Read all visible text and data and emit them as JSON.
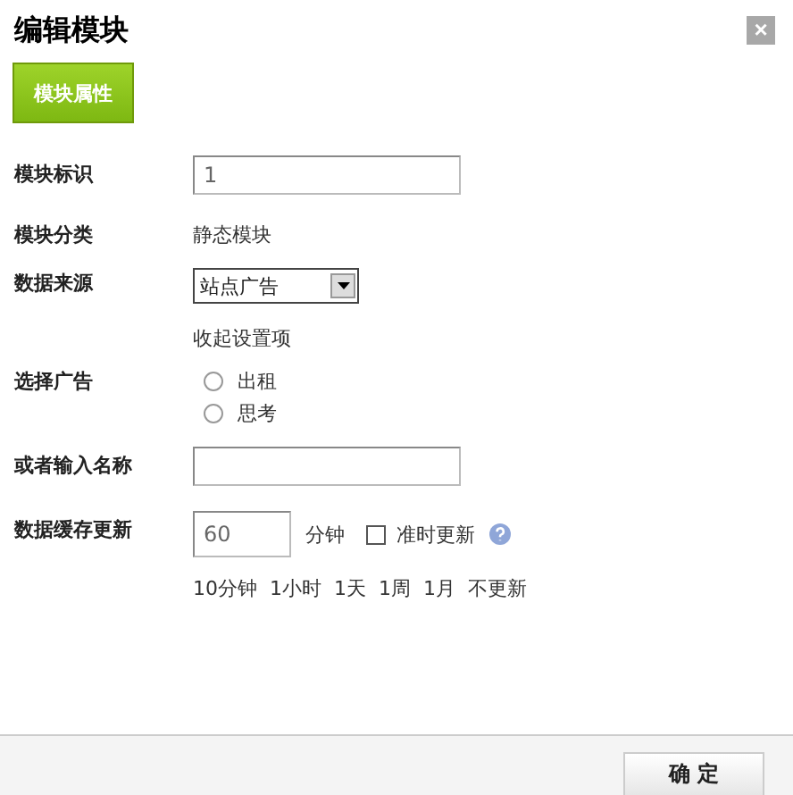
{
  "window": {
    "title": "编辑模块",
    "close": "×"
  },
  "tabs": [
    {
      "label": "模块属性",
      "selected": true
    }
  ],
  "fields": [
    {
      "kind": "input",
      "label": "模块标识",
      "value": "1"
    },
    {
      "kind": "text",
      "label": "模块分类",
      "value": "静态模块"
    },
    {
      "kind": "select",
      "label": "数据来源",
      "value": "站点广告",
      "link": "收起设置项"
    },
    {
      "kind": "radio",
      "label": "选择广告",
      "options": [
        {
          "label": "出租",
          "selected": false
        },
        {
          "label": "思考",
          "selected": false
        }
      ]
    },
    {
      "kind": "input",
      "label": "或者输入名称"
    },
    {
      "kind": "cache",
      "label": "数据缓存更新",
      "value": "60",
      "unit": "分钟",
      "checkbox": {
        "label": "准时更新",
        "checked": false
      },
      "presets": [
        "10分钟",
        "1小时",
        "1天",
        "1周",
        "1月",
        "不更新"
      ]
    }
  ],
  "buttons": [
    "确 定"
  ]
}
